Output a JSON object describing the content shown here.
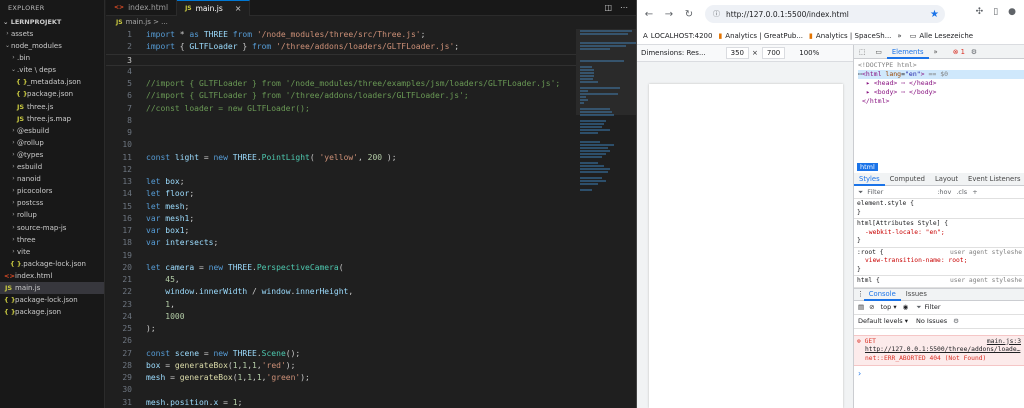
{
  "explorer": {
    "title": "EXPLORER",
    "project": "LERNPROJEKT",
    "items": [
      {
        "label": "assets",
        "type": "folder",
        "indent": 1
      },
      {
        "label": "node_modules",
        "type": "folder-open",
        "indent": 1
      },
      {
        "label": ".bin",
        "type": "folder",
        "indent": 2
      },
      {
        "label": ".vite \\ deps",
        "type": "folder-open",
        "indent": 2
      },
      {
        "label": "_metadata.json",
        "type": "json",
        "indent": 3
      },
      {
        "label": "package.json",
        "type": "json",
        "indent": 3
      },
      {
        "label": "three.js",
        "type": "js",
        "indent": 3
      },
      {
        "label": "three.js.map",
        "type": "js",
        "indent": 3
      },
      {
        "label": "@esbuild",
        "type": "folder",
        "indent": 2
      },
      {
        "label": "@rollup",
        "type": "folder",
        "indent": 2
      },
      {
        "label": "@types",
        "type": "folder",
        "indent": 2
      },
      {
        "label": "esbuild",
        "type": "folder",
        "indent": 2
      },
      {
        "label": "nanoid",
        "type": "folder",
        "indent": 2
      },
      {
        "label": "picocolors",
        "type": "folder",
        "indent": 2
      },
      {
        "label": "postcss",
        "type": "folder",
        "indent": 2
      },
      {
        "label": "rollup",
        "type": "folder",
        "indent": 2
      },
      {
        "label": "source-map-js",
        "type": "folder",
        "indent": 2
      },
      {
        "label": "three",
        "type": "folder",
        "indent": 2
      },
      {
        "label": "vite",
        "type": "folder",
        "indent": 2
      },
      {
        "label": ".package-lock.json",
        "type": "json",
        "indent": 2
      },
      {
        "label": "index.html",
        "type": "html",
        "indent": 1
      },
      {
        "label": "main.js",
        "type": "js",
        "indent": 1,
        "active": true
      },
      {
        "label": "package-lock.json",
        "type": "json",
        "indent": 1
      },
      {
        "label": "package.json",
        "type": "json",
        "indent": 1
      }
    ]
  },
  "editor": {
    "tabs": [
      {
        "label": "index.html",
        "icon": "<>",
        "active": false
      },
      {
        "label": "main.js",
        "icon": "JS",
        "active": true,
        "close": "×"
      }
    ],
    "breadcrumb": "main.js > ...",
    "breadcrumb_icon": "JS",
    "lines": [
      {
        "n": "1",
        "html": "<span class='kw'>import</span> * <span class='kw'>as</span> <span class='var'>THREE</span> <span class='kw'>from</span> <span class='str'>'/node_modules/three/src/Three.js'</span>;"
      },
      {
        "n": "2",
        "html": "<span class='kw'>import</span> { <span class='var'>GLTFLoader</span> } <span class='kw'>from</span> <span class='str'>'/three/addons/loaders/GLTFLoader.js'</span>;"
      },
      {
        "n": "3",
        "html": "",
        "current": true
      },
      {
        "n": "4",
        "html": ""
      },
      {
        "n": "5",
        "html": "<span class='cm'>//import { GLTFLoader } from '/node_modules/three/examples/jsm/loaders/GLTFLoader.js';</span>"
      },
      {
        "n": "6",
        "html": "<span class='cm'>//import { GLTFLoader } from '/three/addons/loaders/GLTFLoader.js';</span>"
      },
      {
        "n": "7",
        "html": "<span class='cm'>//const loader = new GLTFLoader();</span>"
      },
      {
        "n": "8",
        "html": ""
      },
      {
        "n": "9",
        "html": ""
      },
      {
        "n": "10",
        "html": ""
      },
      {
        "n": "11",
        "html": "<span class='kw'>const</span> <span class='var'>light</span> = <span class='kw'>new</span> <span class='var'>THREE</span>.<span class='cls'>PointLight</span>( <span class='str'>'yellow'</span>, <span class='num'>200</span> );"
      },
      {
        "n": "12",
        "html": ""
      },
      {
        "n": "13",
        "html": "<span class='kw'>let</span> <span class='var'>box</span>;"
      },
      {
        "n": "14",
        "html": "<span class='kw'>let</span> <span class='var'>floor</span>;"
      },
      {
        "n": "15",
        "html": "<span class='kw'>let</span> <span class='var'>mesh</span>;"
      },
      {
        "n": "16",
        "html": "<span class='kw'>var</span> <span class='var'>mesh1</span>;"
      },
      {
        "n": "17",
        "html": "<span class='kw'>var</span> <span class='var'>box1</span>;"
      },
      {
        "n": "18",
        "html": "<span class='kw'>var</span> <span class='var'>intersects</span>;"
      },
      {
        "n": "19",
        "html": ""
      },
      {
        "n": "20",
        "html": "<span class='kw'>let</span> <span class='var'>camera</span> = <span class='kw'>new</span> <span class='var'>THREE</span>.<span class='cls'>PerspectiveCamera</span>("
      },
      {
        "n": "21",
        "html": "    <span class='num'>45</span>,"
      },
      {
        "n": "22",
        "html": "    <span class='var'>window</span>.<span class='var'>innerWidth</span> / <span class='var'>window</span>.<span class='var'>innerHeight</span>,"
      },
      {
        "n": "23",
        "html": "    <span class='num'>1</span>,"
      },
      {
        "n": "24",
        "html": "    <span class='num'>1000</span>"
      },
      {
        "n": "25",
        "html": ");"
      },
      {
        "n": "26",
        "html": ""
      },
      {
        "n": "27",
        "html": "<span class='kw'>const</span> <span class='var'>scene</span> = <span class='kw'>new</span> <span class='var'>THREE</span>.<span class='cls'>Scene</span>();"
      },
      {
        "n": "28",
        "html": "<span class='var'>box</span> = <span class='fn'>generateBox</span>(<span class='num'>1</span>,<span class='num'>1</span>,<span class='num'>1</span>,<span class='str'>'red'</span>);"
      },
      {
        "n": "29",
        "html": "<span class='var'>mesh</span> = <span class='fn'>generateBox</span>(<span class='num'>1</span>,<span class='num'>1</span>,<span class='num'>1</span>,<span class='str'>'green'</span>);"
      },
      {
        "n": "30",
        "html": ""
      },
      {
        "n": "31",
        "html": "<span class='var'>mesh</span>.<span class='var'>position</span>.<span class='var'>x</span> = <span class='num'>1</span>;"
      }
    ]
  },
  "browser": {
    "url": "http://127.0.0.1:5500/index.html",
    "bookmarks": [
      {
        "label": "LOCALHOST:4200",
        "icon": "A"
      },
      {
        "label": "Analytics | GreatPub...",
        "icon": "▮"
      },
      {
        "label": "Analytics | SpaceSh...",
        "icon": "▮"
      }
    ],
    "bookmarks_overflow": "»",
    "bookmarks_folder": "Alle Lesezeiche",
    "device": {
      "label": "Dimensions: Res...",
      "width": "350",
      "height": "700",
      "zoom": "100%"
    },
    "devtools": {
      "top_tabs": [
        "Elements",
        "»"
      ],
      "error_count": "1",
      "dom": {
        "doctype": "<!DOCTYPE html>",
        "html_open": "html",
        "html_attr": "lang",
        "html_attr_val": "\"en\"",
        "html_marker": "== $0",
        "head": "<head> ⋯ </head>",
        "body": "<body> ⋯ </body>",
        "html_close": "</html>"
      },
      "crumb": "html",
      "style_tabs": [
        "Styles",
        "Computed",
        "Layout",
        "Event Listeners",
        "»"
      ],
      "filter_placeholder": "Filter",
      "filter_hov": ":hov",
      "filter_cls": ".cls",
      "rules": [
        {
          "sel": "element.style {",
          "lines": [
            "}"
          ],
          "ua": ""
        },
        {
          "sel": "html[Attributes Style] {",
          "lines": [
            "-webkit-locale: \"en\";",
            "}"
          ],
          "ua": ""
        },
        {
          "sel": ":root {",
          "lines": [
            "view-transition-name: root;",
            "}"
          ],
          "ua": "user agent styleshe"
        },
        {
          "sel": "html {",
          "lines": [],
          "ua": "user agent styleshe"
        }
      ],
      "console_tabs": [
        "Console",
        "Issues"
      ],
      "console_context": "top ▾",
      "console_filter": "Filter",
      "default_levels": "Default levels ▾",
      "no_issues": "No Issues",
      "error": {
        "method": "GET",
        "url": "http://127.0.0.1:5500/three/addons/loade…",
        "message": "net::ERR_ABORTED 404 (Not Found)",
        "source": "main.js:3"
      },
      "prompt": "›"
    }
  },
  "colors": {
    "vscode_bg": "#1e1e1e",
    "accent": "#0078d4",
    "error": "#d93025",
    "devtools_accent": "#1a73e8"
  }
}
